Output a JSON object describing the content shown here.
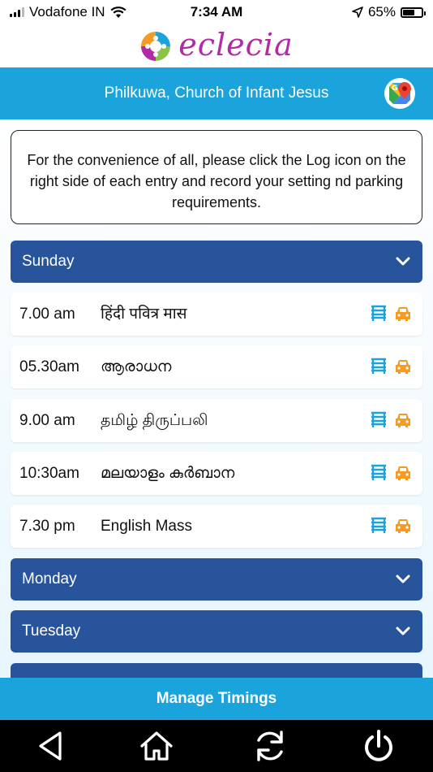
{
  "status_bar": {
    "carrier": "Vodafone IN",
    "time": "7:34 AM",
    "battery_percent": "65%",
    "battery_level": 0.65
  },
  "header": {
    "app_name": "eclecia",
    "church_title": "Philkuwa, Church of Infant Jesus",
    "brand_color": "#b32aa6",
    "title_bar_color": "#1ba3dc"
  },
  "notice": {
    "text": "For the convenience of all, please click the Log icon on the right side of each entry and record your setting nd parking requirements."
  },
  "days": [
    {
      "label": "Sunday",
      "expanded": true,
      "masses": [
        {
          "time": "7.00 am",
          "name": "हिंदी पवित्र मास"
        },
        {
          "time": "05.30am",
          "name": "ആരാധന"
        },
        {
          "time": "9.00 am",
          "name": "தமிழ் திருப்பலி"
        },
        {
          "time": "10:30am",
          "name": "മലയാളം കുർബാന"
        },
        {
          "time": "7.30 pm",
          "name": "English Mass"
        }
      ]
    },
    {
      "label": "Monday",
      "expanded": false
    },
    {
      "label": "Tuesday",
      "expanded": false
    }
  ],
  "row_icons": {
    "seating": "bench-icon",
    "parking": "car-icon",
    "seating_color": "#1ba3dc",
    "parking_color": "#f59a23"
  },
  "footer": {
    "manage_label": "Manage Timings"
  },
  "nav": [
    "back-icon",
    "home-icon",
    "refresh-icon",
    "power-icon"
  ],
  "day_header_color": "#27549b"
}
